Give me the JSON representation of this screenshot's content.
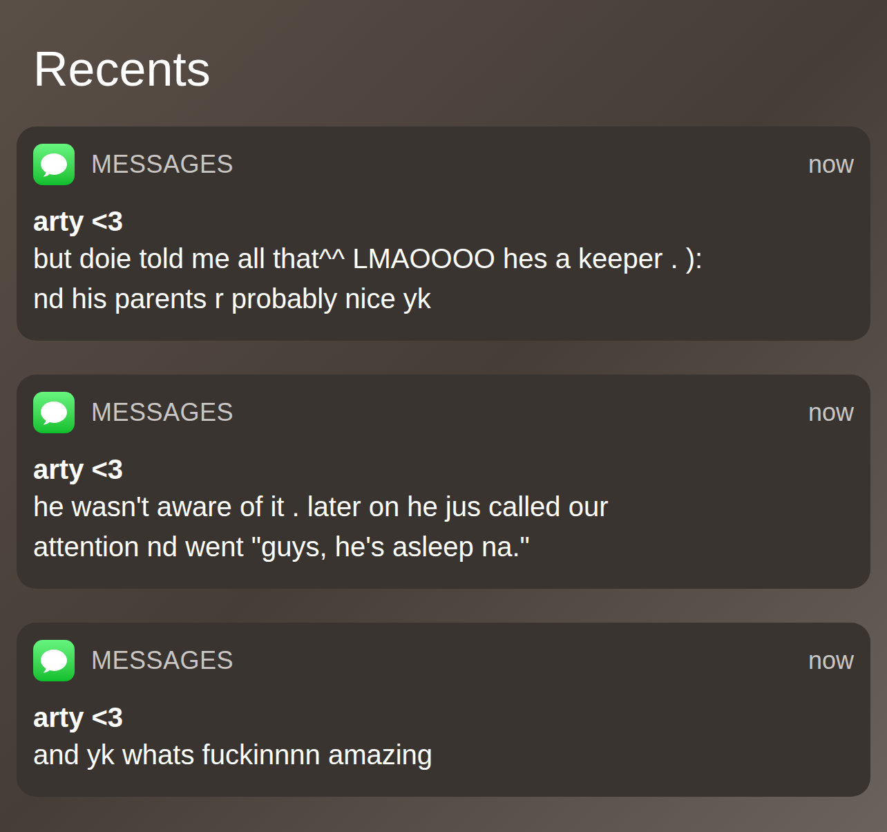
{
  "header": {
    "title": "Recents"
  },
  "notifications": [
    {
      "app": "MESSAGES",
      "time": "now",
      "sender": "arty <3",
      "lines": [
        "but doie told me all that^^ LMAOOOO hes a keeper . ):",
        "nd his parents r probably nice yk"
      ]
    },
    {
      "app": "MESSAGES",
      "time": "now",
      "sender": "arty <3",
      "lines": [
        "he wasn't aware of it . later on he jus called our",
        "attention nd went \"guys, he's asleep na.\""
      ]
    },
    {
      "app": "MESSAGES",
      "time": "now",
      "sender": "arty <3",
      "lines": [
        "and yk whats fuckinnnn amazing"
      ]
    }
  ]
}
